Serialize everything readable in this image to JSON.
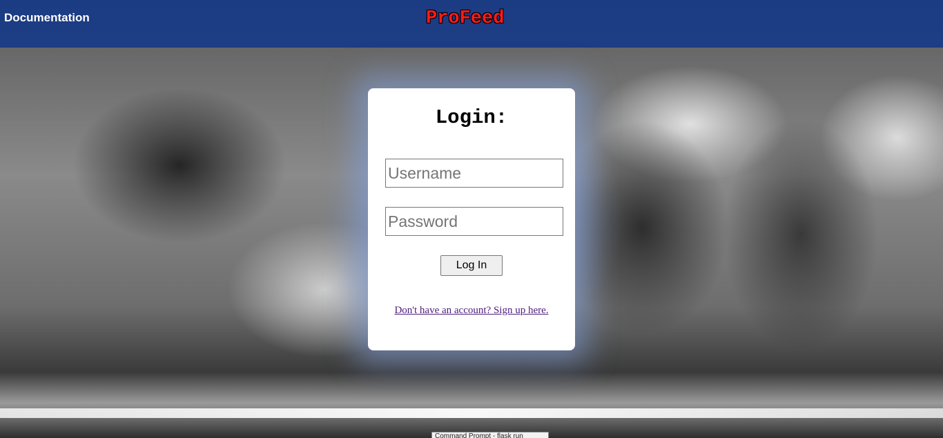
{
  "header": {
    "documentation_label": "Documentation",
    "brand_title": "ProFeed"
  },
  "login": {
    "title": "Login:",
    "username_placeholder": "Username",
    "password_placeholder": "Password",
    "submit_label": "Log In",
    "signup_link": "Don't have an account? Sign up here."
  },
  "taskbar": {
    "tooltip": "Command Prompt - flask run"
  },
  "colors": {
    "header_bg": "#0e348c",
    "brand": "#ff1a1a",
    "link_visited": "#4b1c7c"
  }
}
